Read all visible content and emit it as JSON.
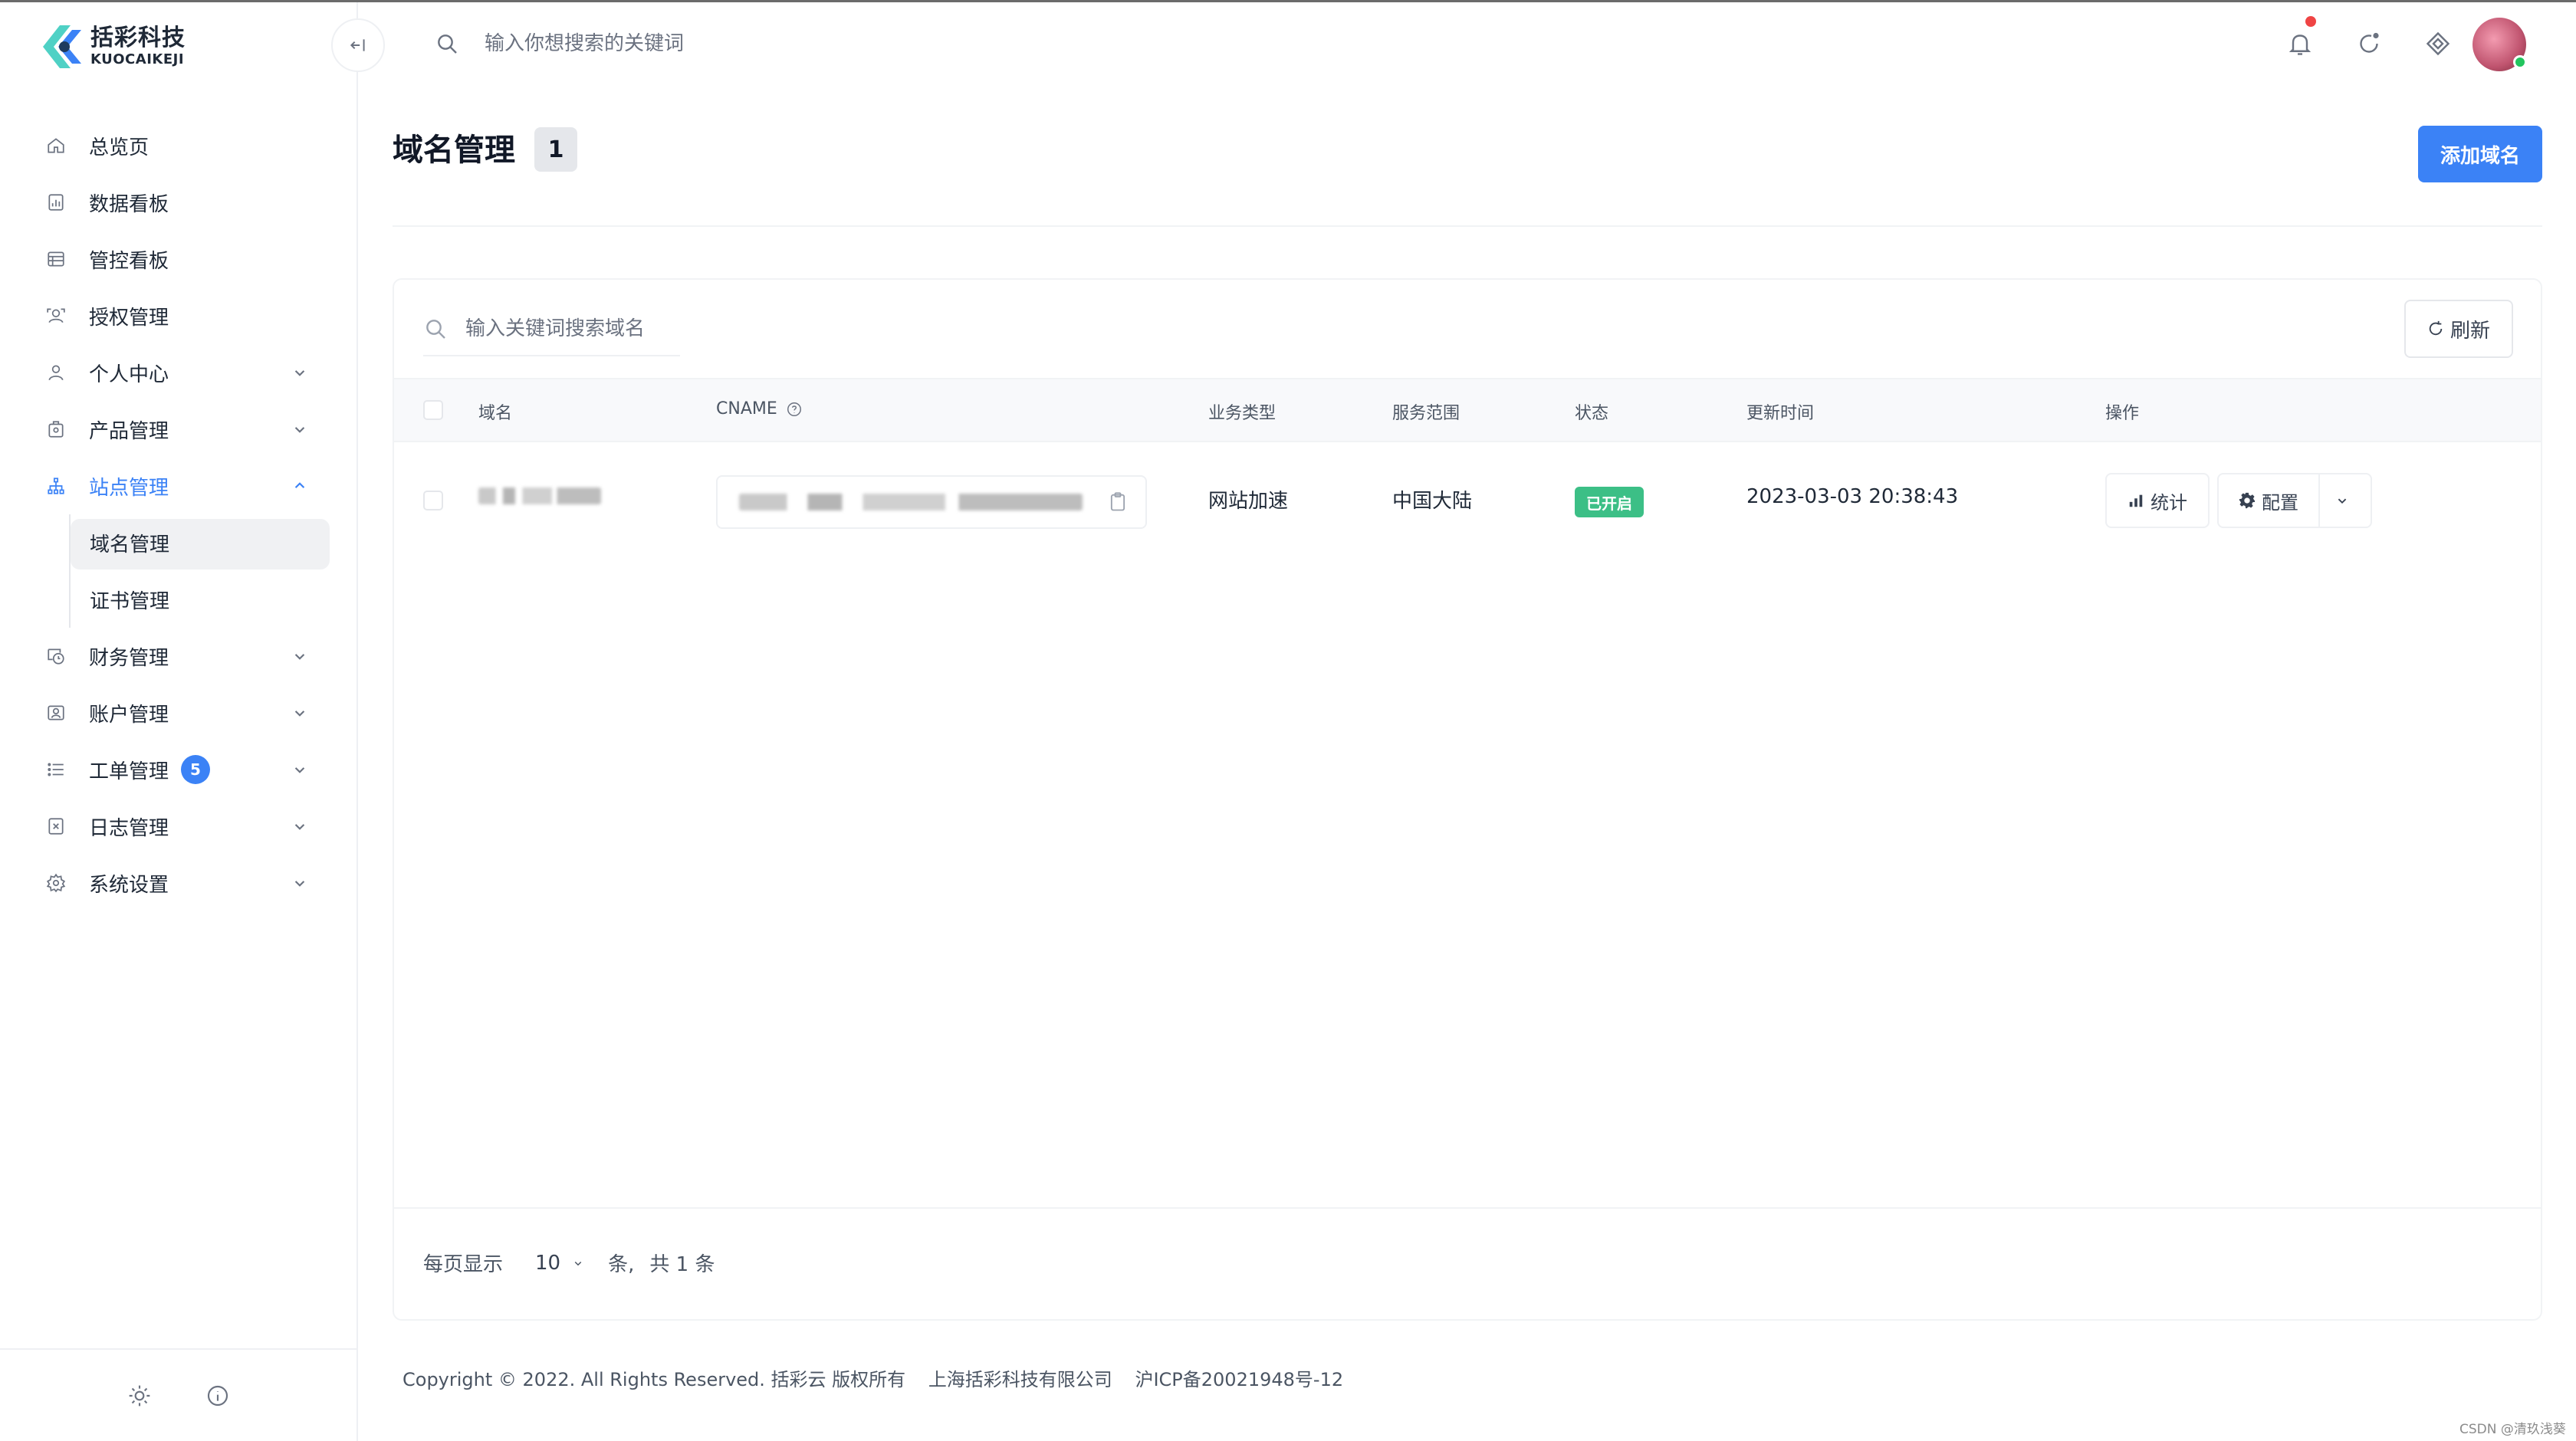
{
  "brand": {
    "name_cn": "括彩科技",
    "name_en": "KUOCAIKEJI",
    "colors": {
      "teal": "#4fd1c5",
      "blue": "#3b82f6",
      "dark": "#1e3a5f"
    }
  },
  "topbar": {
    "search_placeholder": "输入你想搜索的关键词",
    "icons": [
      "bell-icon",
      "refresh-icon",
      "diamond-icon"
    ],
    "notification_dot_color": "#ef4444"
  },
  "sidebar": {
    "items": [
      {
        "label": "总览页",
        "icon": "home-icon"
      },
      {
        "label": "数据看板",
        "icon": "data-board-icon"
      },
      {
        "label": "管控看板",
        "icon": "control-board-icon"
      },
      {
        "label": "授权管理",
        "icon": "auth-icon"
      },
      {
        "label": "个人中心",
        "icon": "user-icon",
        "expandable": true
      },
      {
        "label": "产品管理",
        "icon": "product-icon",
        "expandable": true
      },
      {
        "label": "站点管理",
        "icon": "site-icon",
        "expandable": true,
        "expanded": true,
        "active": true,
        "children": [
          {
            "label": "域名管理",
            "selected": true
          },
          {
            "label": "证书管理"
          }
        ]
      },
      {
        "label": "财务管理",
        "icon": "finance-icon",
        "expandable": true
      },
      {
        "label": "账户管理",
        "icon": "account-icon",
        "expandable": true
      },
      {
        "label": "工单管理",
        "icon": "ticket-icon",
        "expandable": true,
        "badge": "5"
      },
      {
        "label": "日志管理",
        "icon": "log-icon",
        "expandable": true
      },
      {
        "label": "系统设置",
        "icon": "settings-icon",
        "expandable": true
      }
    ],
    "bottom_icons": [
      "sun-icon",
      "info-icon"
    ]
  },
  "page": {
    "title": "域名管理",
    "count": "1",
    "add_button": "添加域名"
  },
  "table": {
    "search_placeholder": "输入关键词搜索域名",
    "refresh_label": "刷新",
    "columns": [
      "域名",
      "CNAME",
      "业务类型",
      "服务范围",
      "状态",
      "更新时间",
      "操作"
    ],
    "rows": [
      {
        "domain": "",
        "cname": "",
        "business_type": "网站加速",
        "service_scope": "中国大陆",
        "status": "已开启",
        "updated_at": "2023-03-03 20:38:43"
      }
    ],
    "actions": {
      "stats": "统计",
      "config": "配置"
    }
  },
  "pagination": {
    "prefix": "每页显示",
    "page_size": "10",
    "unit": "条,",
    "total": "共 1 条"
  },
  "footer": {
    "copyright": "Copyright © 2022. All Rights Reserved. 括彩云 版权所有",
    "company": "上海括彩科技有限公司",
    "icp": "沪ICP备20021948号-12"
  },
  "watermark": "CSDN @清玖浅葵"
}
